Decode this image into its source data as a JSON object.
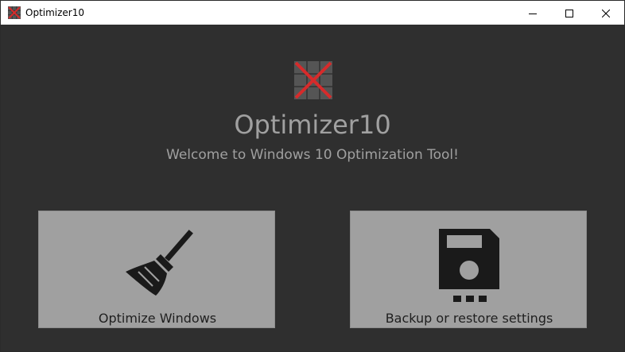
{
  "window": {
    "title": "Optimizer10",
    "controls": {
      "minimize_icon": "minimize-icon",
      "maximize_icon": "maximize-icon",
      "close_icon": "close-icon"
    }
  },
  "header": {
    "app_name": "Optimizer10",
    "welcome": "Welcome to Windows 10 Optimization Tool!",
    "logo_icon": "app-logo-icon"
  },
  "actions": [
    {
      "label": "Optimize Windows",
      "icon": "broom-icon"
    },
    {
      "label": "Backup or restore settings",
      "icon": "floppy-disk-icon"
    }
  ],
  "colors": {
    "background": "#2f2f2f",
    "text_muted": "#a0a0a0",
    "tile": "#a0a0a0",
    "icon_dark": "#1a1a1a",
    "logo_cross": "#d62b2b",
    "logo_grid": "#555555"
  }
}
